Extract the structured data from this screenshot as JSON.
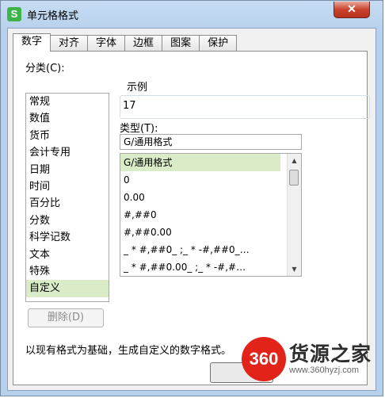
{
  "window": {
    "title": "单元格格式",
    "app_icon_letter": "S",
    "close_glyph": "✕"
  },
  "tabs": [
    {
      "label": "数字",
      "active": true
    },
    {
      "label": "对齐"
    },
    {
      "label": "字体"
    },
    {
      "label": "边框"
    },
    {
      "label": "图案"
    },
    {
      "label": "保护"
    }
  ],
  "category": {
    "label": "分类(C):",
    "items": [
      "常规",
      "数值",
      "货币",
      "会计专用",
      "日期",
      "时间",
      "百分比",
      "分数",
      "科学记数",
      "文本",
      "特殊",
      "自定义"
    ],
    "selected": "自定义"
  },
  "sample": {
    "label": "示例",
    "value": "17"
  },
  "type": {
    "label": "类型(T):",
    "input_value": "G/通用格式",
    "items": [
      "G/通用格式",
      "0",
      "0.00",
      "#,##0",
      "#,##0.00",
      "_ * #,##0_ ;_ * -#,##0_…",
      "_ * #,##0.00_ ;_ * -#,#…"
    ],
    "selected": "G/通用格式"
  },
  "delete_button": "删除(D)",
  "description": "以现有格式为基础，生成自定义的数字格式。",
  "watermark": {
    "logo_text": "360",
    "name": "货源之家",
    "url": "www.360hyzj.com"
  },
  "icons": {
    "scroll_up": "▲",
    "scroll_down": "▼"
  }
}
